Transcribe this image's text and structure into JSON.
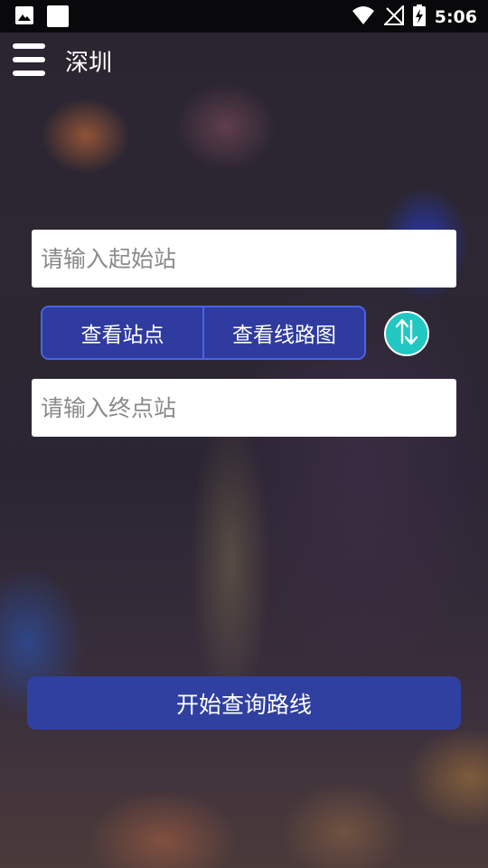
{
  "status_bar": {
    "time": "5:06",
    "left_icons": [
      "image-icon",
      "app-notification-icon"
    ],
    "right_icons": [
      "wifi-icon",
      "no-signal-icon",
      "battery-charging-icon"
    ]
  },
  "app_bar": {
    "menu_icon": "hamburger-menu-icon",
    "city": "深圳"
  },
  "start_station": {
    "value": "",
    "placeholder": "请输入起始站"
  },
  "end_station": {
    "value": "",
    "placeholder": "请输入终点站"
  },
  "segment": {
    "view_stations_label": "查看站点",
    "view_map_label": "查看线路图"
  },
  "swap_button": {
    "icon": "swap-arrows-icon"
  },
  "query_button": {
    "label": "开始查询路线"
  },
  "colors": {
    "primary_button": "#3040a0",
    "segment_border": "#4a64e6",
    "swap_accent": "#21c7c1"
  }
}
